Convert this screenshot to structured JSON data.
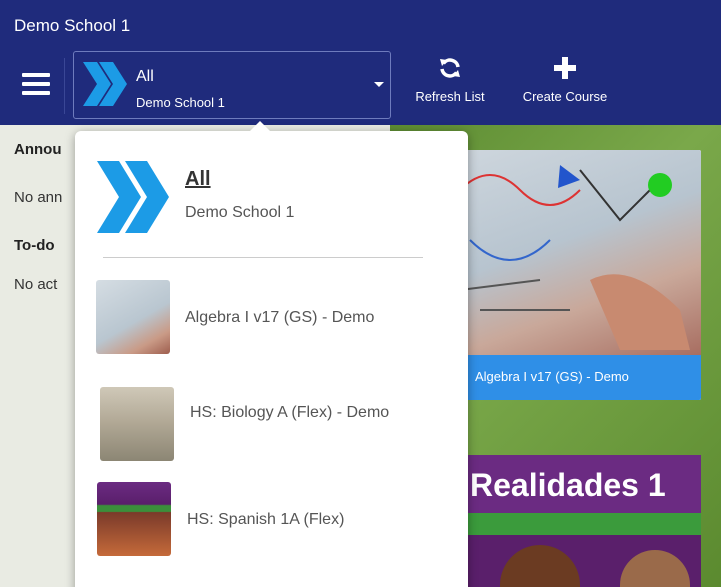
{
  "header": {
    "school_title": "Demo School 1",
    "selector": {
      "primary": "All",
      "secondary": "Demo School 1"
    },
    "refresh_label": "Refresh List",
    "create_label": "Create Course"
  },
  "left_panel": {
    "announcements_title": "Annou",
    "announcements_text": "No ann",
    "todo_title": "To-do",
    "todo_text": "No act"
  },
  "dropdown": {
    "all_label": "All",
    "school_label": "Demo School 1",
    "items": [
      {
        "label": "Algebra I v17 (GS) - Demo"
      },
      {
        "label": "HS: Biology A (Flex) - Demo"
      },
      {
        "label": "HS: Spanish 1A (Flex)"
      }
    ]
  },
  "cards": {
    "card1_label": "Algebra I v17 (GS) - Demo",
    "card2_cover_text": "Realidades 1"
  },
  "colors": {
    "header_bg": "#1f2b7c",
    "accent_blue": "#2f8fe7",
    "chevron_blue": "#1c9be6"
  }
}
